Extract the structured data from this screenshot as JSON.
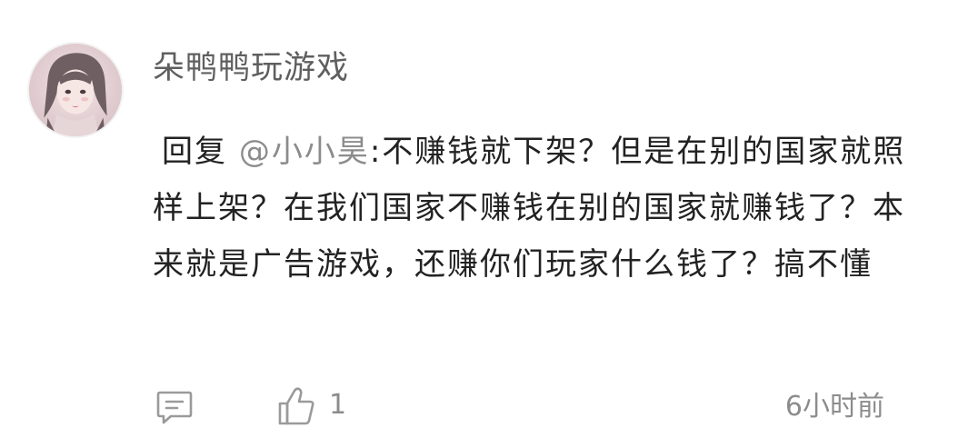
{
  "comment": {
    "username": "朵鸭鸭玩游戏",
    "reply_prefix": "回复 ",
    "mention": "@小小昊",
    "body": ":不赚钱就下架？但是在别的国家就照样上架？在我们国家不赚钱在别的国家就赚钱了？本来就是广告游戏，还赚你们玩家什么钱了？搞不懂",
    "like_count": "1",
    "timestamp": "6小时前"
  },
  "icons": {
    "reply": "comment-bubble-icon",
    "like": "thumbs-up-icon"
  },
  "colors": {
    "username": "#5f5f5f",
    "body_text": "#222222",
    "mention": "#8c8c8c",
    "meta": "#8c8c8c",
    "icon": "#9a9a9a"
  }
}
